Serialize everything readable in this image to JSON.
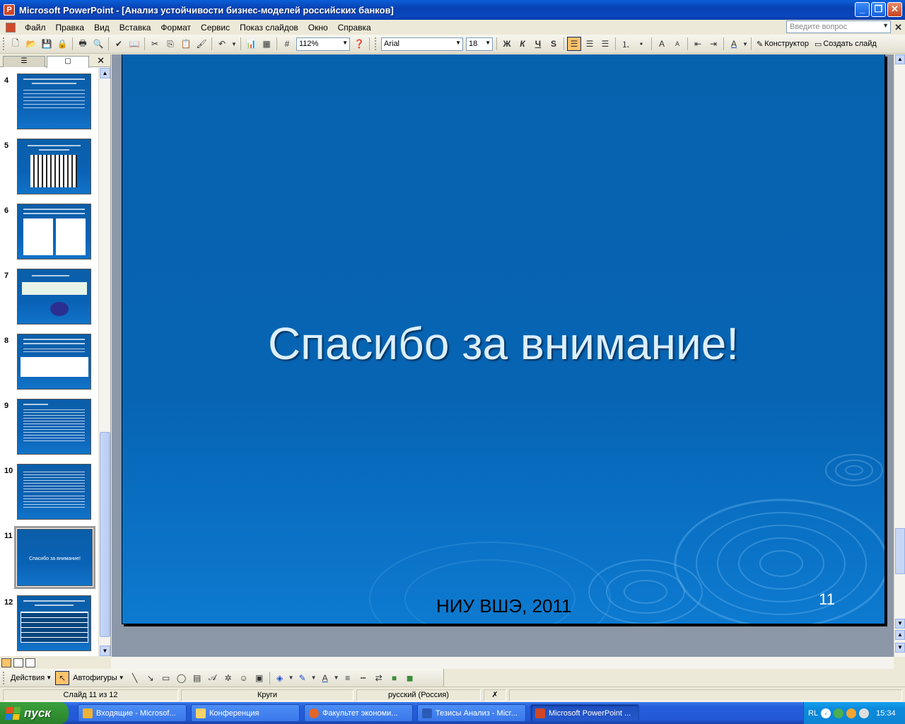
{
  "window": {
    "title": "Microsoft PowerPoint - [Анализ устойчивости бизнес-моделей российских банков]",
    "min_label": "_",
    "restore_label": "❐",
    "close_label": "✕"
  },
  "menu": {
    "items": [
      "Файл",
      "Правка",
      "Вид",
      "Вставка",
      "Формат",
      "Сервис",
      "Показ слайдов",
      "Окно",
      "Справка"
    ],
    "help_placeholder": "Введите вопрос",
    "close_label": "✕"
  },
  "toolbar": {
    "zoom": "112%",
    "font": "Arial",
    "font_size": "18",
    "bold": "Ж",
    "italic": "К",
    "underline": "Ч",
    "shadow": "S",
    "designer_label": "Конструктор",
    "new_slide_label": "Создать слайд"
  },
  "pane": {
    "close_label": "✕",
    "slides": [
      {
        "num": "4",
        "caption": ""
      },
      {
        "num": "5",
        "caption": ""
      },
      {
        "num": "6",
        "caption": ""
      },
      {
        "num": "7",
        "caption": ""
      },
      {
        "num": "8",
        "caption": ""
      },
      {
        "num": "9",
        "caption": ""
      },
      {
        "num": "10",
        "caption": ""
      },
      {
        "num": "11",
        "caption": "Спасибо за внимание!"
      },
      {
        "num": "12",
        "caption": ""
      }
    ],
    "selected": "11"
  },
  "slide": {
    "title": "Спасибо за внимание!",
    "footer": "НИУ ВШЭ, 2011",
    "number": "11"
  },
  "drawing": {
    "actions_label": "Действия",
    "autoshapes_label": "Автофигуры"
  },
  "status": {
    "slide_info": "Слайд 11 из 12",
    "design": "Круги",
    "language": "русский (Россия)"
  },
  "taskbar": {
    "start_label": "пуск",
    "tasks": [
      {
        "label": "Входящие - Microsof...",
        "icon_color": "#F2B233"
      },
      {
        "label": "Конференция",
        "icon_color": "#F4D36B"
      },
      {
        "label": "Факультет экономи...",
        "icon_color": "#E0662A"
      },
      {
        "label": "Тезисы Анализ - Micr...",
        "icon_color": "#2B5BB8"
      },
      {
        "label": "Microsoft PowerPoint ...",
        "icon_color": "#D24726"
      }
    ],
    "lang": "RL",
    "clock": "15:34"
  },
  "colors": {
    "slide_bg": "#0764B3",
    "title_text": "#DCEFFD",
    "xp_blue": "#245EDB"
  }
}
